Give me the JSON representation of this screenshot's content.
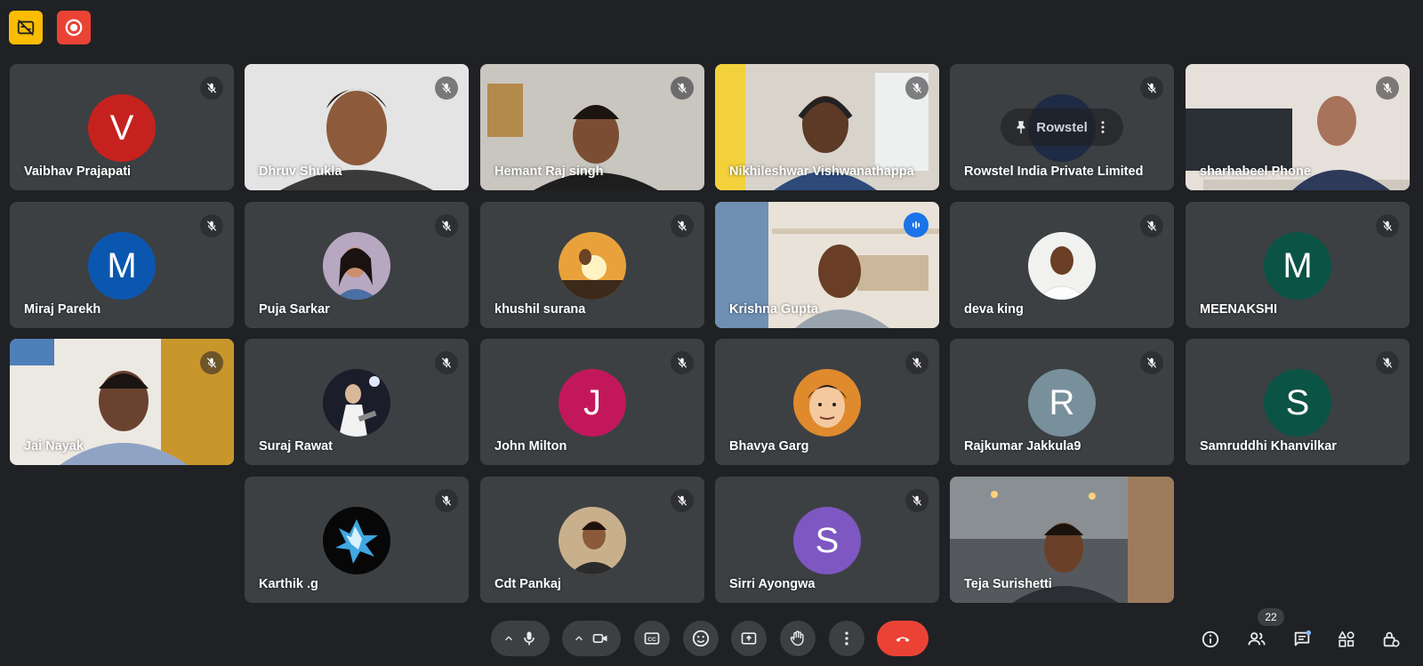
{
  "colors": {
    "background": "#202124",
    "tile": "#3c4043",
    "active_outline": "#8ab4f8",
    "end_call": "#ea4335",
    "captions_off_badge": "#fbbc04",
    "recording_badge": "#ea4335"
  },
  "participants": [
    {
      "name": "Vaibhav Prajapati",
      "initial": "V",
      "avatar_color": "#c5221f"
    },
    {
      "name": "Dhruv Shukla"
    },
    {
      "name": "Hemant Raj singh"
    },
    {
      "name": "Nikhileshwar Vishwanathappa"
    },
    {
      "name": "Rowstel India Private Limited",
      "logo_text": "Rowstel"
    },
    {
      "name": "sharhabeel Phone"
    },
    {
      "name": "Miraj Parekh",
      "initial": "M",
      "avatar_color": "#0b57b0"
    },
    {
      "name": "Puja Sarkar"
    },
    {
      "name": "khushil surana"
    },
    {
      "name": "Krishna Gupta"
    },
    {
      "name": "deva king"
    },
    {
      "name": "MEENAKSHI",
      "initial": "M",
      "avatar_color": "#0b5345"
    },
    {
      "name": "Jai Nayak"
    },
    {
      "name": "Suraj Rawat"
    },
    {
      "name": "John Milton",
      "initial": "J",
      "avatar_color": "#c2185b"
    },
    {
      "name": "Bhavya Garg"
    },
    {
      "name": "Rajkumar Jakkula9",
      "initial": "R",
      "avatar_color": "#78909c"
    },
    {
      "name": "Samruddhi Khanvilkar",
      "initial": "S",
      "avatar_color": "#0b5345"
    },
    {
      "name": "Karthik .g"
    },
    {
      "name": "Cdt Pankaj"
    },
    {
      "name": "Sirri Ayongwa",
      "initial": "S",
      "avatar_color": "#7e57c2"
    },
    {
      "name": "Teja Surishetti"
    }
  ],
  "controls": {
    "mic_icon": "mic-icon",
    "camera_icon": "camera-icon",
    "captions_icon": "captions-icon",
    "emoji_icon": "emoji-icon",
    "present_icon": "present-icon",
    "raise_hand_icon": "raise-hand-icon",
    "more_icon": "more-icon",
    "end_call_icon": "end-call-icon"
  },
  "right_panel": {
    "people_count": "22"
  }
}
